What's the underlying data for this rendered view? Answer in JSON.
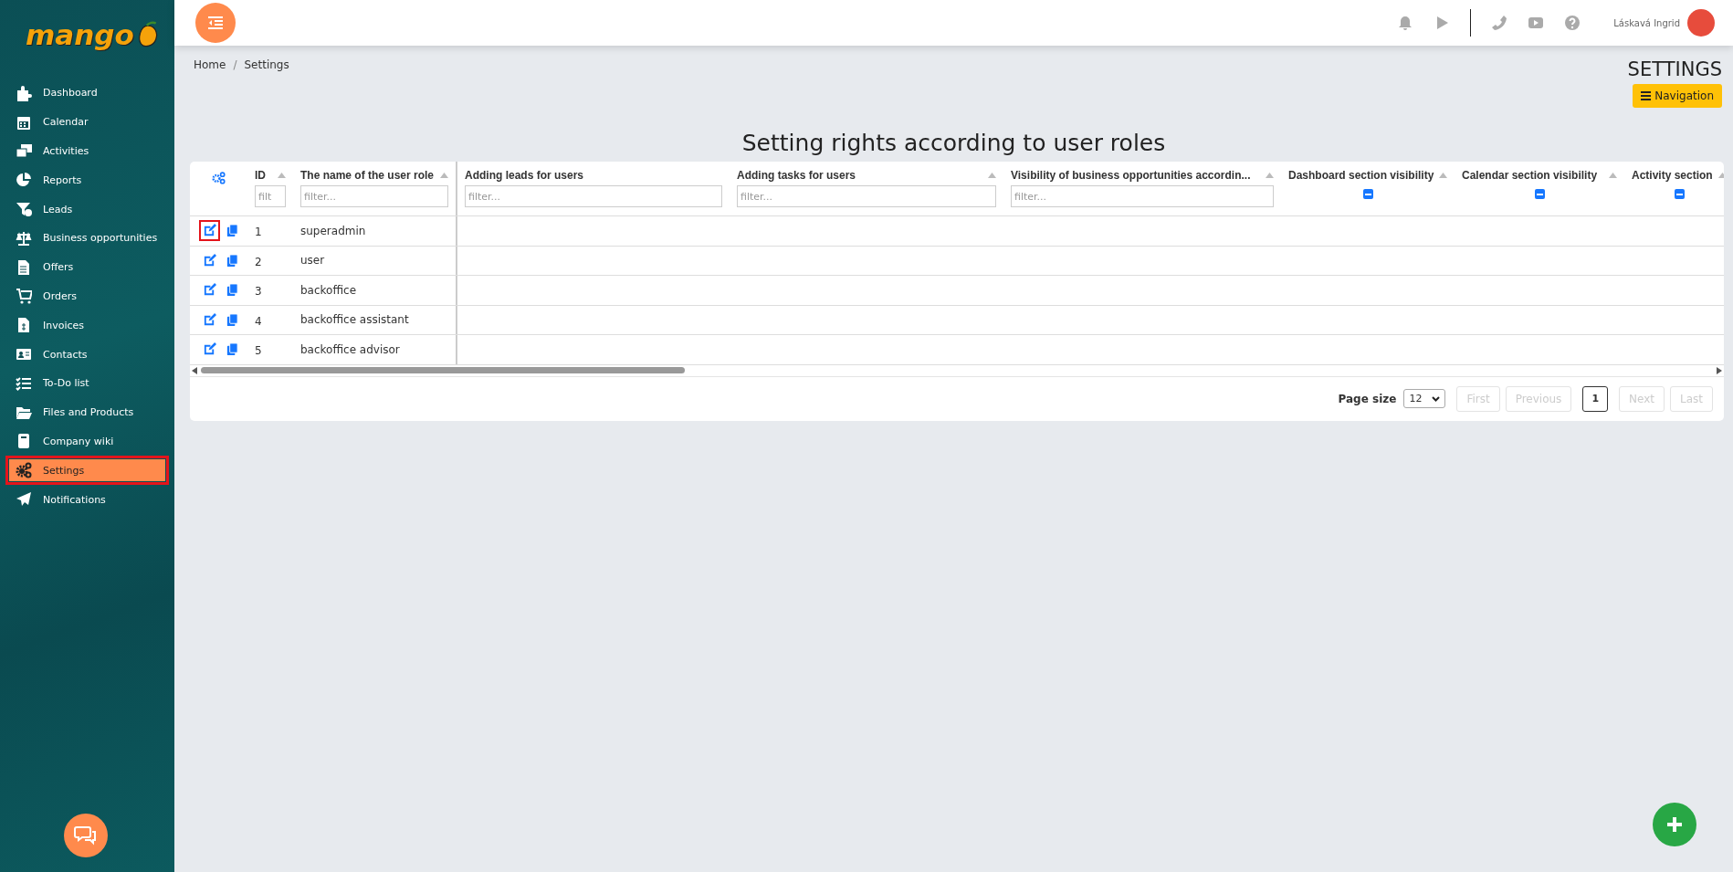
{
  "sidebar": {
    "logo": "mango",
    "items": [
      {
        "label": "Dashboard",
        "selected": false,
        "highlighted": false
      },
      {
        "label": "Calendar",
        "selected": false,
        "highlighted": false
      },
      {
        "label": "Activities",
        "selected": false,
        "highlighted": false
      },
      {
        "label": "Reports",
        "selected": false,
        "highlighted": false
      },
      {
        "label": "Leads",
        "selected": false,
        "highlighted": false
      },
      {
        "label": "Business opportunities",
        "selected": false,
        "highlighted": false
      },
      {
        "label": "Offers",
        "selected": false,
        "highlighted": false
      },
      {
        "label": "Orders",
        "selected": false,
        "highlighted": false
      },
      {
        "label": "Invoices",
        "selected": false,
        "highlighted": false
      },
      {
        "label": "Contacts",
        "selected": false,
        "highlighted": false
      },
      {
        "label": "To-Do list",
        "selected": false,
        "highlighted": false
      },
      {
        "label": "Files and Products",
        "selected": false,
        "highlighted": false
      },
      {
        "label": "Company wiki",
        "selected": false,
        "highlighted": false
      },
      {
        "label": "Settings",
        "selected": true,
        "highlighted": true
      },
      {
        "label": "Notifications",
        "selected": false,
        "highlighted": false
      }
    ]
  },
  "topbar": {
    "user_name": "Láskavá Ingrid"
  },
  "breadcrumb": {
    "items": [
      "Home",
      "Settings"
    ],
    "separator": "/"
  },
  "page_title": "SETTINGS",
  "navigation_button": "Navigation",
  "heading": "Setting rights according to user roles",
  "table": {
    "columns": [
      {
        "label": "ID",
        "filter": {
          "kind": "text",
          "placeholder": "filt"
        }
      },
      {
        "label": "The name of the user role",
        "filter": {
          "kind": "text",
          "placeholder": "filter..."
        }
      },
      {
        "label": "Adding leads for users",
        "filter": {
          "kind": "text",
          "placeholder": "filter..."
        }
      },
      {
        "label": "Adding tasks for users",
        "filter": {
          "kind": "text",
          "placeholder": "filter..."
        }
      },
      {
        "label": "Visibility of business opportunities accordin...",
        "filter": {
          "kind": "text",
          "placeholder": "filter..."
        }
      },
      {
        "label": "Dashboard section visibility",
        "filter": {
          "kind": "checkbox",
          "indeterminate": true
        }
      },
      {
        "label": "Calendar section visibility",
        "filter": {
          "kind": "checkbox",
          "indeterminate": true
        }
      },
      {
        "label": "Activity section",
        "filter": {
          "kind": "checkbox",
          "indeterminate": true
        }
      }
    ],
    "rows": [
      {
        "id": "1",
        "name": "superadmin",
        "edit_highlighted": true
      },
      {
        "id": "2",
        "name": "user",
        "edit_highlighted": false
      },
      {
        "id": "3",
        "name": "backoffice",
        "edit_highlighted": false
      },
      {
        "id": "4",
        "name": "backoffice assistant",
        "edit_highlighted": false
      },
      {
        "id": "5",
        "name": "backoffice advisor",
        "edit_highlighted": false
      }
    ]
  },
  "pagination": {
    "page_size_label": "Page size",
    "page_size": "12",
    "buttons": [
      {
        "label": "First",
        "kind": "nav",
        "disabled": true,
        "selected": false
      },
      {
        "label": "Previous",
        "kind": "nav",
        "disabled": true,
        "selected": false
      },
      {
        "label": "1",
        "kind": "page",
        "disabled": false,
        "selected": true
      },
      {
        "label": "Next",
        "kind": "nav",
        "disabled": true,
        "selected": false
      },
      {
        "label": "Last",
        "kind": "nav",
        "disabled": true,
        "selected": false
      }
    ]
  }
}
